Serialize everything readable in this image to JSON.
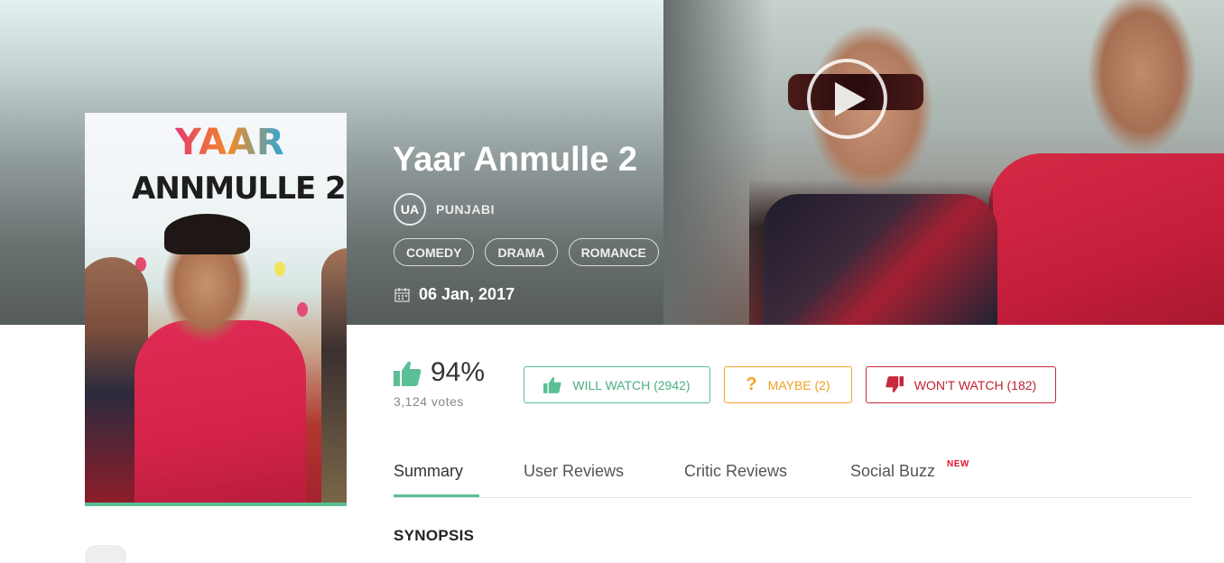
{
  "movie": {
    "title": "Yaar Anmulle 2",
    "certificate": "UA",
    "language": "PUNJABI",
    "genres": [
      "COMEDY",
      "DRAMA",
      "ROMANCE"
    ],
    "release_date": "06 Jan, 2017"
  },
  "poster": {
    "title_line1": "YAAR",
    "title_line2": "ANNMULLE 2"
  },
  "rating": {
    "percent": "94%",
    "votes": "3,124 votes"
  },
  "actions": {
    "will_watch": "WILL WATCH (2942)",
    "maybe": "MAYBE (2)",
    "wont_watch": "WON'T WATCH (182)"
  },
  "tabs": [
    {
      "label": "Summary",
      "active": true
    },
    {
      "label": "User Reviews"
    },
    {
      "label": "Critic Reviews"
    },
    {
      "label": "Social Buzz",
      "badge": "NEW"
    }
  ],
  "synopsis": {
    "heading": "SYNOPSIS"
  },
  "colors": {
    "accent_green": "#5bbf95",
    "maybe_orange": "#f2a427",
    "wont_red": "#c8283c"
  },
  "icons": [
    "play-icon",
    "calendar-icon",
    "thumbs-up-icon",
    "question-icon",
    "thumbs-down-icon"
  ]
}
